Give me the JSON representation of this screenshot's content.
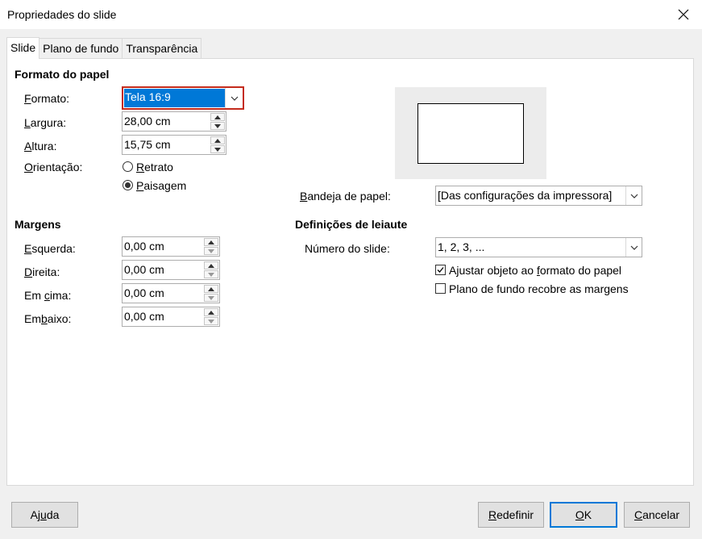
{
  "window": {
    "title": "Propriedades do slide"
  },
  "tabs": [
    {
      "label": "Slide",
      "active": true
    },
    {
      "label": "Plano de fundo",
      "active": false
    },
    {
      "label": "Transparência",
      "active": false
    }
  ],
  "paper_format": {
    "heading": "Formato do papel",
    "format": {
      "pre": "",
      "u": "F",
      "post": "ormato:",
      "value": "Tela 16:9"
    },
    "width": {
      "pre": "",
      "u": "L",
      "post": "argura:",
      "value": "28,00 cm"
    },
    "height": {
      "pre": "",
      "u": "A",
      "post": "ltura:",
      "value": "15,75 cm"
    },
    "orientation": {
      "label": {
        "pre": "",
        "u": "O",
        "post": "rientação:"
      },
      "portrait": {
        "pre": "",
        "u": "R",
        "post": "etrato",
        "checked": false
      },
      "landscape": {
        "pre": "",
        "u": "P",
        "post": "aisagem",
        "checked": true
      }
    },
    "paper_tray": {
      "pre": "",
      "u": "B",
      "post": "andeja de papel:",
      "value": "[Das configurações da impressora]"
    }
  },
  "margins": {
    "heading": "Margens",
    "left": {
      "pre": "",
      "u": "E",
      "post": "squerda:",
      "value": "0,00 cm"
    },
    "right": {
      "pre": "",
      "u": "D",
      "post": "ireita:",
      "value": "0,00 cm"
    },
    "top": {
      "pre": "Em ",
      "u": "c",
      "post": "ima:",
      "value": "0,00 cm"
    },
    "bottom": {
      "pre": "Em",
      "u": "b",
      "post": "aixo:",
      "value": "0,00 cm"
    }
  },
  "layout": {
    "heading": "Definições de leiaute",
    "slide_numbers": {
      "label": "Número do slide:",
      "value": "1, 2, 3, ..."
    },
    "fit_object": {
      "pre": "Ajustar objeto ao ",
      "u": "f",
      "post": "ormato do papel",
      "checked": true
    },
    "bg_covers_margins": {
      "label": "Plano de fundo recobre as margens",
      "checked": false
    }
  },
  "buttons": {
    "help": {
      "pre": "Aj",
      "u": "u",
      "post": "da"
    },
    "reset": {
      "pre": "",
      "u": "R",
      "post": "edefinir"
    },
    "ok": {
      "pre": "",
      "u": "O",
      "post": "K"
    },
    "cancel": {
      "pre": "",
      "u": "C",
      "post": "ancelar"
    }
  },
  "colors": {
    "selection": "#0078d7",
    "focus_border": "#c42b1c",
    "default_button": "#0078d7"
  }
}
